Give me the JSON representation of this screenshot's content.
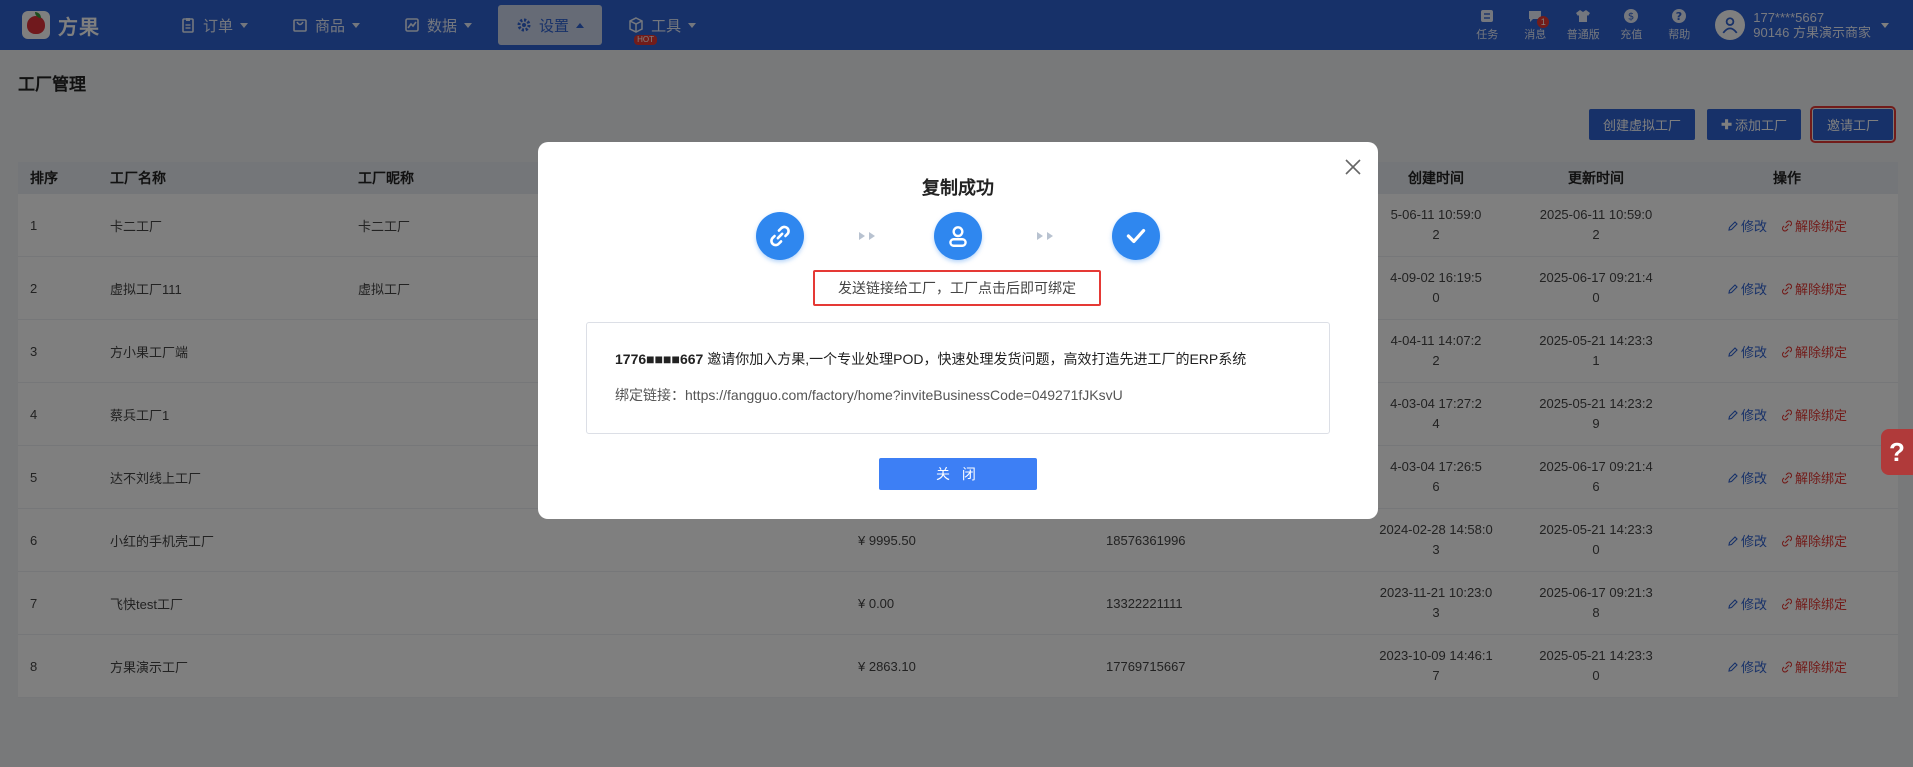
{
  "app": {
    "logo_text": "方果",
    "colors": {
      "nav_bg": "#2f62d2",
      "danger": "#e53935",
      "primary": "#2f62d2"
    }
  },
  "nav": {
    "items": [
      {
        "label": "订单",
        "icon": "clipboard-icon"
      },
      {
        "label": "商品",
        "icon": "shopping-bag-icon"
      },
      {
        "label": "数据",
        "icon": "chart-icon"
      },
      {
        "label": "设置",
        "icon": "gear-icon",
        "active": true
      },
      {
        "label": "工具",
        "icon": "box-icon",
        "badge": "HOT"
      }
    ]
  },
  "tools": [
    {
      "label": "任务",
      "icon": "task-icon"
    },
    {
      "label": "消息",
      "icon": "message-icon",
      "badge": "1"
    },
    {
      "label": "普通版",
      "icon": "shirt-icon"
    },
    {
      "label": "充值",
      "icon": "coin-icon"
    },
    {
      "label": "帮助",
      "icon": "help-icon"
    }
  ],
  "user": {
    "phone": "177****5667",
    "company": "90146 方果演示商家"
  },
  "page": {
    "title": "工厂管理",
    "buttons": {
      "create_virtual": "创建虚拟工厂",
      "add": "添加工厂",
      "invite": "邀请工厂"
    }
  },
  "table": {
    "headers": [
      "排序",
      "工厂名称",
      "工厂昵称",
      "",
      "",
      "创建时间",
      "更新时间",
      "操作"
    ],
    "edit_label": "修改",
    "unbind_label": "解除绑定",
    "rows": [
      {
        "idx": "1",
        "name": "卡二工厂",
        "nick": "卡二工厂",
        "amount": "",
        "phone": "",
        "created": "5-06-11 10:59:0",
        "created2": "2",
        "updated": "2025-06-11 10:59:0",
        "updated2": "2"
      },
      {
        "idx": "2",
        "name": "虚拟工厂111",
        "nick": "虚拟工厂",
        "amount": "",
        "phone": "",
        "created": "4-09-02 16:19:5",
        "created2": "0",
        "updated": "2025-06-17 09:21:4",
        "updated2": "0"
      },
      {
        "idx": "3",
        "name": "方小果工厂端",
        "nick": "",
        "amount": "",
        "phone": "",
        "created": "4-04-11 14:07:2",
        "created2": "2",
        "updated": "2025-05-21 14:23:3",
        "updated2": "1"
      },
      {
        "idx": "4",
        "name": "蔡兵工厂1",
        "nick": "",
        "amount": "",
        "phone": "",
        "created": "4-03-04 17:27:2",
        "created2": "4",
        "updated": "2025-05-21 14:23:2",
        "updated2": "9"
      },
      {
        "idx": "5",
        "name": "达不刘线上工厂",
        "nick": "",
        "amount": "",
        "phone": "",
        "created": "4-03-04 17:26:5",
        "created2": "6",
        "updated": "2025-06-17 09:21:4",
        "updated2": "6"
      },
      {
        "idx": "6",
        "name": "小红的手机壳工厂",
        "nick": "",
        "amount": "¥ 9995.50",
        "phone": "18576361996",
        "created": "2024-02-28 14:58:0",
        "created2": "3",
        "updated": "2025-05-21 14:23:3",
        "updated2": "0"
      },
      {
        "idx": "7",
        "name": "飞快test工厂",
        "nick": "",
        "amount": "¥ 0.00",
        "phone": "13322221111",
        "created": "2023-11-21 10:23:0",
        "created2": "3",
        "updated": "2025-06-17 09:21:3",
        "updated2": "8"
      },
      {
        "idx": "8",
        "name": "方果演示工厂",
        "nick": "",
        "amount": "¥ 2863.10",
        "phone": "17769715667",
        "created": "2023-10-09 14:46:1",
        "created2": "7",
        "updated": "2025-05-21 14:23:3",
        "updated2": "0"
      }
    ]
  },
  "modal": {
    "title": "复制成功",
    "hint": "发送链接给工厂，工厂点击后即可绑定",
    "invite_phone": "1776■■■■667",
    "invite_text": " 邀请你加入方果,一个专业处理POD，快速处理发货问题，高效打造先进工厂的ERP系统",
    "link_label": "绑定链接：",
    "link_url": "https://fangguo.com/factory/home?inviteBusinessCode=049271fJKsvU",
    "close_button": "关 闭"
  }
}
